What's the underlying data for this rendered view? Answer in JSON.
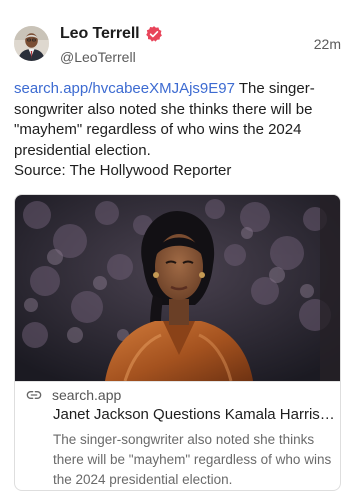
{
  "author": {
    "display_name": "Leo Terrell",
    "handle": "@LeoTerrell",
    "timestamp": "22m",
    "verified_icon": "verified-badge-icon",
    "verified_color": "#e8445a"
  },
  "post": {
    "link": "search.app/hvcabeeXMJAjs9E97",
    "text": " The singer-songwriter also noted she thinks there will be \"mayhem\" regardless of who wins the 2024 presidential election.",
    "source": "Source: The Hollywood Reporter",
    "link_color": "#3d6bd1"
  },
  "card": {
    "domain": "search.app",
    "link_icon": "link-icon",
    "title": "Janet Jackson Questions Kamala Harris' Race",
    "description": "The singer-songwriter also noted she thinks there will be \"mayhem\" regardless of who wins the 2024 presidential election."
  }
}
